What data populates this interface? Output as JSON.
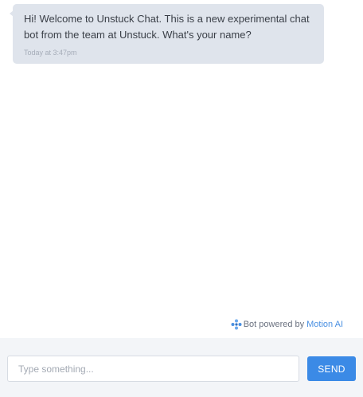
{
  "conversation": {
    "messages": [
      {
        "sender": "bot",
        "text": "Hi! Welcome to Unstuck Chat. This is a new experimental chat bot from the team at Unstuck. What's your name?",
        "timestamp": "Today at 3:47pm"
      }
    ]
  },
  "footer": {
    "powered_prefix": "Bot powered by",
    "powered_link": "Motion AI",
    "logo_icon": "motion-ai-logo-icon"
  },
  "composer": {
    "placeholder": "Type something...",
    "value": "",
    "send_label": "SEND"
  },
  "colors": {
    "bubble_bg": "#dfe4ec",
    "accent": "#3b8ae6",
    "link": "#4a90e2",
    "composer_bg": "#f3f5f8"
  }
}
